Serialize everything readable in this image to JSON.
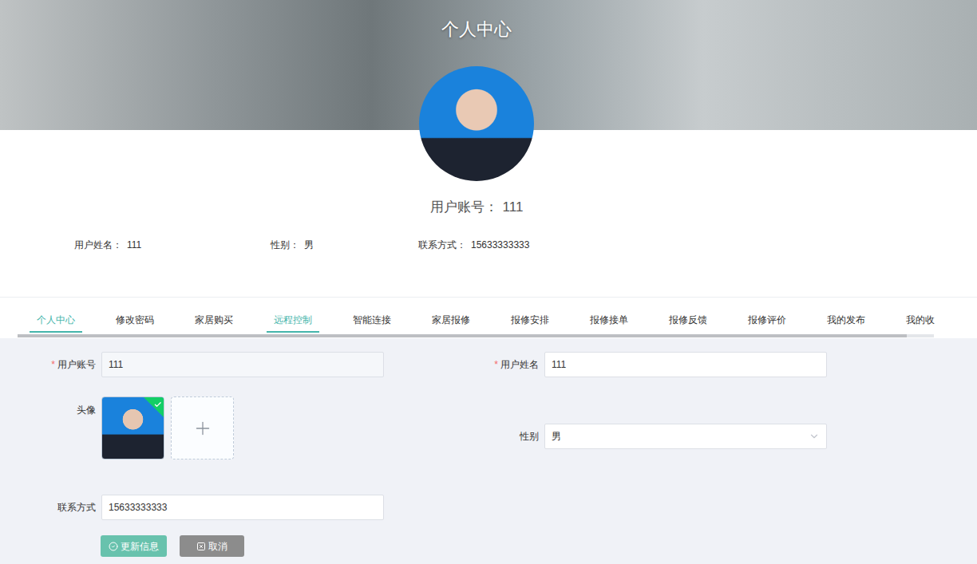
{
  "banner": {
    "title": "个人中心"
  },
  "profile": {
    "account": {
      "label": "用户账号：",
      "value": "111"
    },
    "details": [
      {
        "label": "用户姓名：",
        "value": "111"
      },
      {
        "label": "性别：",
        "value": "男"
      },
      {
        "label": "联系方式：",
        "value": "15633333333"
      }
    ]
  },
  "tabs": [
    {
      "label": "个人中心",
      "selected": true,
      "hovered": false
    },
    {
      "label": "修改密码",
      "selected": false,
      "hovered": false
    },
    {
      "label": "家居购买",
      "selected": false,
      "hovered": false
    },
    {
      "label": "远程控制",
      "selected": false,
      "hovered": true
    },
    {
      "label": "智能连接",
      "selected": false,
      "hovered": false
    },
    {
      "label": "家居报修",
      "selected": false,
      "hovered": false
    },
    {
      "label": "报修安排",
      "selected": false,
      "hovered": false
    },
    {
      "label": "报修接单",
      "selected": false,
      "hovered": false
    },
    {
      "label": "报修反馈",
      "selected": false,
      "hovered": false
    },
    {
      "label": "报修评价",
      "selected": false,
      "hovered": false
    },
    {
      "label": "我的发布",
      "selected": false,
      "hovered": false
    },
    {
      "label": "我的收",
      "selected": false,
      "hovered": false
    }
  ],
  "tab_scrollbar": {
    "level": 0.97
  },
  "form": {
    "fields": [
      {
        "kind": "text",
        "label": "用户账号",
        "value": "111",
        "required": true,
        "disabled": true
      },
      {
        "kind": "text",
        "label": "用户姓名",
        "value": "111",
        "required": true,
        "disabled": false
      },
      {
        "kind": "upload",
        "label": "头像",
        "required": false,
        "disabled": false,
        "uploaded": true
      },
      {
        "kind": "select",
        "label": "性别",
        "value": "男",
        "required": false,
        "disabled": false
      },
      {
        "kind": "text",
        "label": "联系方式",
        "value": "15633333333",
        "required": false,
        "disabled": false
      }
    ]
  },
  "buttons": [
    {
      "label": "更新信息",
      "kind": "primary"
    },
    {
      "label": "取消",
      "kind": "cancel"
    }
  ]
}
